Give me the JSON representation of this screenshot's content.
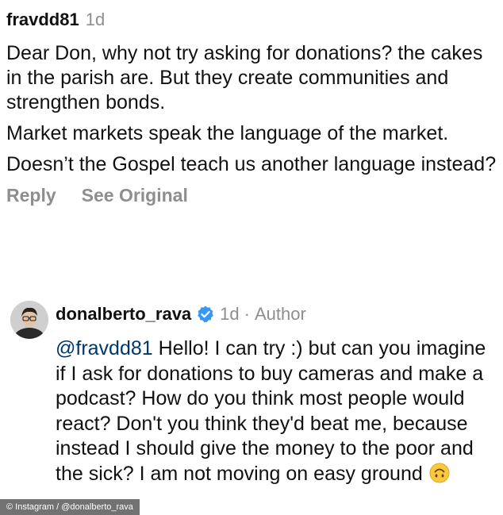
{
  "comment": {
    "username": "fravdd81",
    "time": "1d",
    "paragraphs": [
      "Dear Don, why not try asking for donations? the cakes in the parish are. But they create communities and strengthen bonds.",
      "Market markets speak the language of the market.",
      "Doesn’t the Gospel teach us another language instead?"
    ],
    "reply_label": "Reply",
    "see_original_label": "See Original"
  },
  "reply": {
    "avatar_icon": "avatar-photo",
    "username": "donalberto_rava",
    "verified_icon": "verified-badge-icon",
    "verified_color": "#3897f0",
    "time": "1d",
    "separator": "·",
    "author_label": "Author",
    "mention": "@fravdd81",
    "text": "Hello! I can try :) but can you imagine if I ask for donations to buy cameras and make a podcast? How do you think most people would react? Don't you think they'd beat me, because instead I should give the money to the poor and the sick? I am not moving on easy ground",
    "emoji_icon": "upside-down-face-emoji"
  },
  "credit": "© Instagram / @donalberto_rava"
}
